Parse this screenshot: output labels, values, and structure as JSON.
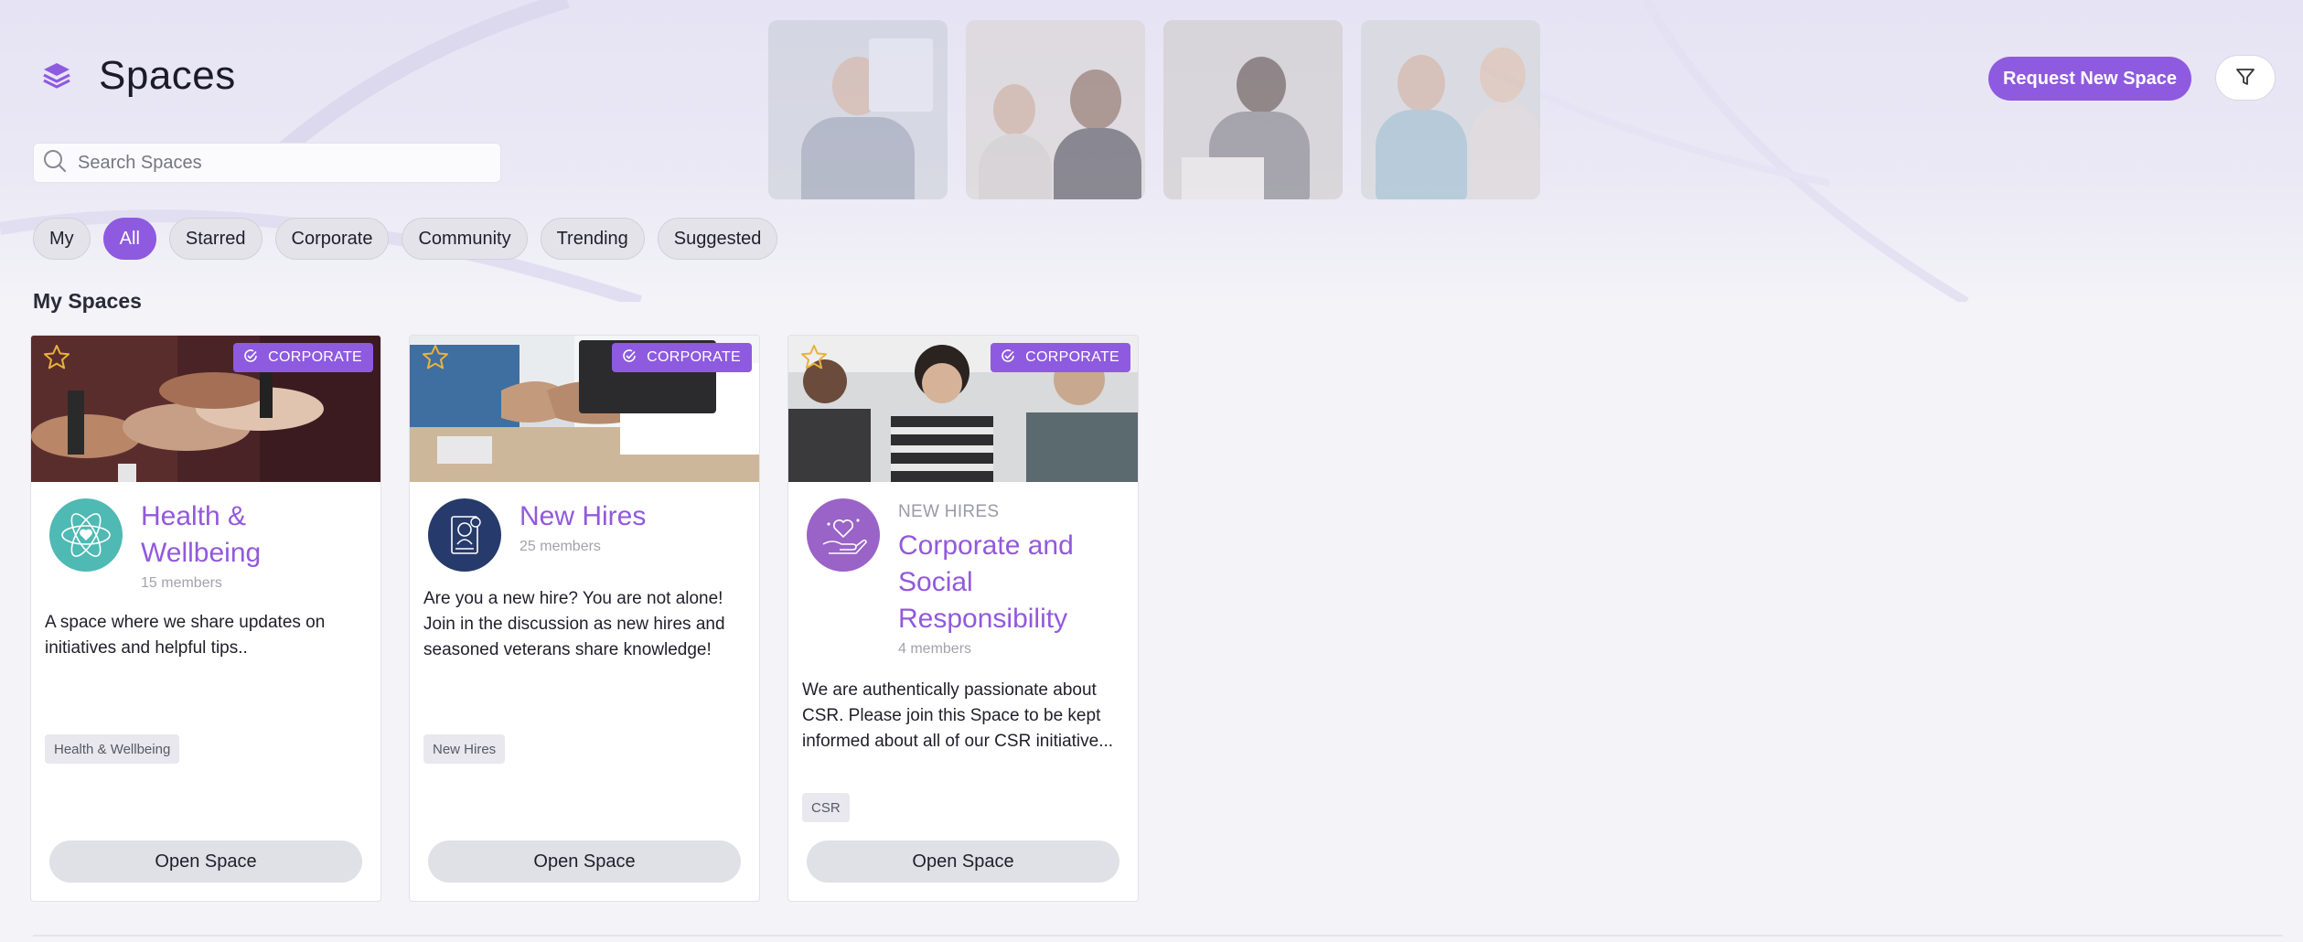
{
  "header": {
    "title": "Spaces",
    "request_button": "Request New Space"
  },
  "search": {
    "placeholder": "Search Spaces",
    "value": ""
  },
  "filters": [
    {
      "label": "My",
      "active": false
    },
    {
      "label": "All",
      "active": true
    },
    {
      "label": "Starred",
      "active": false
    },
    {
      "label": "Corporate",
      "active": false
    },
    {
      "label": "Community",
      "active": false
    },
    {
      "label": "Trending",
      "active": false
    },
    {
      "label": "Suggested",
      "active": false
    }
  ],
  "section_title": "My Spaces",
  "cards": [
    {
      "badge": "CORPORATE",
      "eyebrow": "",
      "title": "Health & Wellbeing",
      "members": "15 members",
      "description": "A space where we share updates on initiatives and helpful tips..",
      "tag": "Health & Wellbeing",
      "open_button": "Open Space",
      "avatar_icon": "atom-heart-icon"
    },
    {
      "badge": "CORPORATE",
      "eyebrow": "",
      "title": "New Hires",
      "members": "25 members",
      "description": "Are you a new hire? You are not alone! Join in the discussion as new hires and seasoned veterans share knowledge!",
      "tag": "New Hires",
      "open_button": "Open Space",
      "avatar_icon": "id-document-icon"
    },
    {
      "badge": "CORPORATE",
      "eyebrow": "NEW HIRES",
      "title": "Corporate and Social Responsibility",
      "members": "4 members",
      "description": "We are authentically passionate about CSR. Please join this Space to be kept informed about all of our CSR initiative...",
      "tag": "CSR",
      "open_button": "Open Space",
      "avatar_icon": "heart-hand-icon"
    }
  ],
  "colors": {
    "accent": "#8e5ae0",
    "title_purple": "#9259dc",
    "star": "#e9b23a",
    "avatar_teal": "#4fb9b4",
    "avatar_navy": "#263a6b",
    "avatar_purple": "#9a63c8"
  }
}
